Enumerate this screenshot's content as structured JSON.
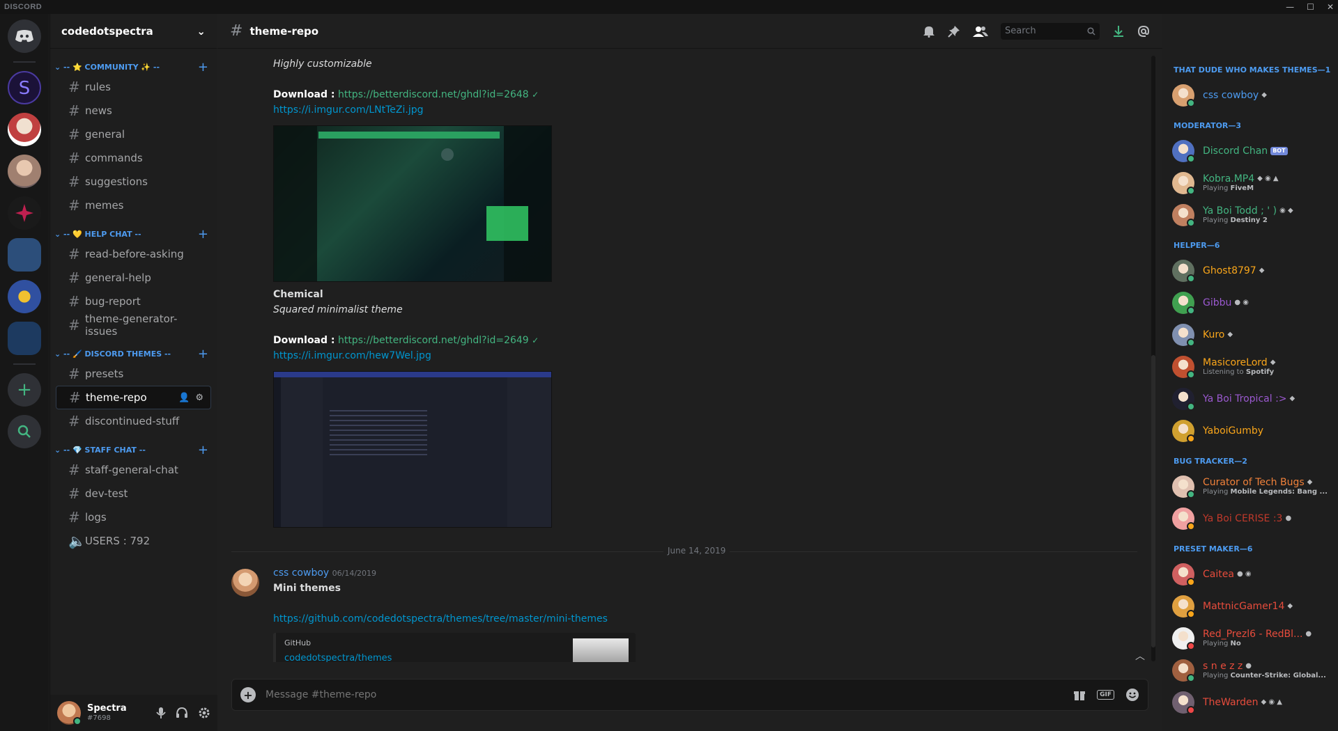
{
  "app": {
    "brand": "DISCORD",
    "win_minimize": "—",
    "win_maximize": "☐",
    "win_close": "✕"
  },
  "server": {
    "name": "codedotspectra",
    "dropdown": "⌄"
  },
  "categories": [
    {
      "label": "-- ⭐ COMMUNITY ✨ --",
      "channels": [
        {
          "name": "rules"
        },
        {
          "name": "news"
        },
        {
          "name": "general"
        },
        {
          "name": "commands"
        },
        {
          "name": "suggestions"
        },
        {
          "name": "memes"
        }
      ]
    },
    {
      "label": "-- 💛 HELP CHAT --",
      "channels": [
        {
          "name": "read-before-asking"
        },
        {
          "name": "general-help"
        },
        {
          "name": "bug-report"
        },
        {
          "name": "theme-generator-issues"
        }
      ]
    },
    {
      "label": "-- 🖌️ DISCORD THEMES --",
      "channels": [
        {
          "name": "presets"
        },
        {
          "name": "theme-repo"
        },
        {
          "name": "discontinued-stuff"
        }
      ]
    },
    {
      "label": "-- 💎 STAFF CHAT --",
      "channels": [
        {
          "name": "staff-general-chat"
        },
        {
          "name": "dev-test"
        },
        {
          "name": "logs"
        },
        {
          "name": "USERS : 792"
        }
      ]
    }
  ],
  "user": {
    "name": "Spectra",
    "tag": "#7698"
  },
  "channel": {
    "title": "theme-repo",
    "search_placeholder": "Search"
  },
  "messages": {
    "neutron_desc": "Highly customizable",
    "download_label": "Download :",
    "neutron_dl": "https://betterdiscord.net/ghdl?id=2648",
    "neutron_img": "https://i.imgur.com/LNtTeZi.jpg",
    "chem_title": "Chemical",
    "chem_desc": "Squared minimalist theme",
    "chem_dl": "https://betterdiscord.net/ghdl?id=2649",
    "chem_img": "https://i.imgur.com/hew7Wel.jpg",
    "divider_date": "June 14, 2019",
    "author": "css cowboy",
    "timestamp": "06/14/2019",
    "mini_title": "Mini themes",
    "mini_link": "https://github.com/codedotspectra/themes/tree/master/mini-themes",
    "embed_provider": "GitHub",
    "embed_title": "codedotspectra/themes"
  },
  "composer": {
    "placeholder": "Message #theme-repo",
    "gif": "GIF"
  },
  "members": [
    {
      "role": "THAT DUDE WHO MAKES THEMES—1",
      "people": [
        {
          "name": "css cowboy",
          "color": "#4d9bf0",
          "status": "online",
          "badges": "◆"
        }
      ]
    },
    {
      "role": "MODERATOR—3",
      "people": [
        {
          "name": "Discord Chan",
          "color": "#43b581",
          "status": "online",
          "bot": "BOT"
        },
        {
          "name": "Kobra.MP4",
          "color": "#43b581",
          "status": "online",
          "badges": "◆ ◉ ▲",
          "verb": "Playing",
          "game": "FiveM"
        },
        {
          "name": "Ya Boi Todd ; ' )",
          "color": "#43b581",
          "status": "online",
          "badges": "◉ ◆",
          "verb": "Playing",
          "game": "Destiny 2"
        }
      ]
    },
    {
      "role": "HELPER—6",
      "people": [
        {
          "name": "Ghost8797",
          "color": "#faa61a",
          "status": "online",
          "badges": "◆"
        },
        {
          "name": "Gibbu",
          "color": "#9b59d0",
          "status": "online",
          "badges": "● ◉"
        },
        {
          "name": "Kuro",
          "color": "#faa61a",
          "status": "online",
          "badges": "◆"
        },
        {
          "name": "MasicoreLord",
          "color": "#faa61a",
          "status": "online",
          "badges": "◆",
          "verb": "Listening to",
          "game": "Spotify"
        },
        {
          "name": "Ya Boi Tropical :>",
          "color": "#9b59d0",
          "status": "online",
          "badges": "◆"
        },
        {
          "name": "YaboiGumby",
          "color": "#faa61a",
          "status": "idle"
        }
      ]
    },
    {
      "role": "BUG TRACKER—2",
      "people": [
        {
          "name": "Curator of Tech Bugs",
          "color": "#f0813a",
          "status": "online",
          "badges": "◆",
          "verb": "Playing",
          "game": "Mobile Legends: Bang ..."
        },
        {
          "name": "Ya Boi CERISE :3",
          "color": "#c0392b",
          "status": "idle",
          "badges": "●"
        }
      ]
    },
    {
      "role": "PRESET MAKER—6",
      "people": [
        {
          "name": "Caitea",
          "color": "#e74c3c",
          "status": "idle",
          "badges": "● ◉"
        },
        {
          "name": "MattnicGamer14",
          "color": "#e74c3c",
          "status": "idle",
          "badges": "◆"
        },
        {
          "name": "Red_Prezl6 - RedBl...",
          "color": "#e74c3c",
          "status": "dnd",
          "badges": "●",
          "verb": "Playing",
          "game": "No"
        },
        {
          "name": "s n e z z",
          "color": "#e74c3c",
          "status": "online",
          "badges": "●",
          "verb": "Playing",
          "game": "Counter-Strike: Global..."
        },
        {
          "name": "TheWarden",
          "color": "#e74c3c",
          "status": "dnd",
          "badges": "◆ ◉ ▲"
        }
      ]
    }
  ]
}
